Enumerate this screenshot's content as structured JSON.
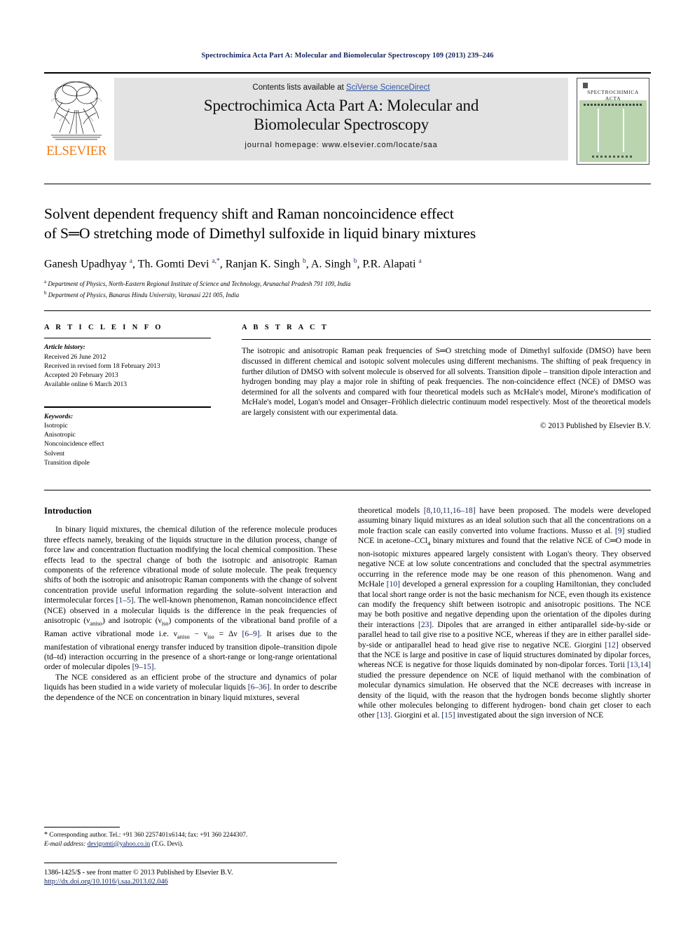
{
  "running_head": "Spectrochimica Acta Part A: Molecular and Biomolecular Spectroscopy 109 (2013) 239–246",
  "masthead": {
    "publisher_logo_text": "ELSEVIER",
    "contents_prefix": "Contents lists available at ",
    "contents_link": "SciVerse ScienceDirect",
    "journal_title_line1": "Spectrochimica Acta Part A: Molecular and",
    "journal_title_line2": "Biomolecular Spectroscopy",
    "homepage": "journal homepage: www.elsevier.com/locate/saa",
    "cover_title_line1": "SPECTROCHIMICA",
    "cover_title_line2": "ACTA"
  },
  "article": {
    "title_line1": "Solvent dependent frequency shift and Raman noncoincidence effect",
    "title_line2": "of S═O stretching mode of Dimethyl sulfoxide in liquid binary mixtures",
    "authors": "Ganesh Upadhyay <sup>a</sup>, Th. Gomti Devi <sup>a,*</sup>, Ranjan K. Singh <sup>b</sup>, A. Singh <sup>b</sup>, P.R. Alapati <sup>a</sup>",
    "affiliation_a": "<sup>a</sup> Department of Physics, North-Eastern Regional Institute of Science and Technology, Arunachal Pradesh 791 109, India",
    "affiliation_b": "<sup>b</sup> Department of Physics, Banaras Hindu University, Varanasi 221 005, India"
  },
  "article_info": {
    "heading": "A R T I C L E  I N F O",
    "history_label": "Article history:",
    "history": [
      "Received 26 June 2012",
      "Received in revised form 18 February 2013",
      "Accepted 20 February 2013",
      "Available online 6 March 2013"
    ],
    "keywords_label": "Keywords:",
    "keywords": [
      "Isotropic",
      "Anisotropic",
      "Noncoincidence effect",
      "Solvent",
      "Transition dipole"
    ]
  },
  "abstract": {
    "heading": "A B S T R A C T",
    "text": "The isotropic and anisotropic Raman peak frequencies of S═O stretching mode of Dimethyl sulfoxide (DMSO) have been discussed in different chemical and isotopic solvent molecules using different mechanisms. The shifting of peak frequency in further dilution of DMSO with solvent molecule is observed for all solvents. Transition dipole – transition dipole interaction and hydrogen bonding may play a major role in shifting of peak frequencies. The non-coincidence effect (NCE) of DMSO was determined for all the solvents and compared with four theoretical models such as McHale's model, Mirone's modification of McHale's model, Logan's model and Onsager–Fröhlich dielectric continuum model respectively. Most of the theoretical models are largely consistent with our experimental data.",
    "copyright": "© 2013 Published by Elsevier B.V."
  },
  "body": {
    "intro_heading": "Introduction",
    "left_para1": "In binary liquid mixtures, the chemical dilution of the reference molecule produces three effects namely, breaking of the liquids structure in the dilution process, change of force law and concentration fluctuation modifying the local chemical composition. These effects lead to the spectral change of both the isotropic and anisotropic Raman components of the reference vibrational mode of solute molecule. The peak frequency shifts of both the isotropic and anisotropic Raman components with the change of solvent concentration provide useful information regarding the solute–solvent interaction and intermolecular forces [1–5]. The well-known phenomenon, Raman noncoincidence effect (NCE) observed in a molecular liquids is the difference in the peak frequencies of anisotropic (&nu;<span class=\"sub\">aniso</span>) and isotropic (&nu;<span class=\"sub\">iso</span>) components of the vibrational band profile of a Raman active vibrational mode i.e. &nu;<span class=\"sub\">aniso</span> − &nu;<span class=\"sub\">iso</span> = &Delta;&nu; [6–9]. It arises due to the manifestation of vibrational energy transfer induced by transition dipole–transition dipole (td–td) interaction occurring in the presence of a short-range or long-range orientational order of molecular dipoles [9–15].",
    "left_para2": "The NCE considered as an efficient probe of the structure and dynamics of polar liquids has been studied in a wide variety of molecular liquids [6–36]. In order to describe the dependence of the NCE on concentration in binary liquid mixtures, several",
    "right_para1": "theoretical models [8,10,11,16–18] have been proposed. The models were developed assuming binary liquid mixtures as an ideal solution such that all the concentrations on a mole fraction scale can easily converted into volume fractions. Musso et al. [9] studied NCE in acetone–CCl<span class=\"sub\">4</span> binary mixtures and found that the relative NCE of C═O mode in non-isotopic mixtures appeared largely consistent with Logan's theory. They observed negative NCE at low solute concentrations and concluded that the spectral asymmetries occurring in the reference mode may be one reason of this phenomenon. Wang and McHale [10] developed a general expression for a coupling Hamiltonian, they concluded that local short range order is not the basic mechanism for NCE, even though its existence can modify the frequency shift between isotropic and anisotropic positions. The NCE may be both positive and negative depending upon the orientation of the dipoles during their interactions [23]. Dipoles that are arranged in either antiparallel side-by-side or parallel head to tail give rise to a positive NCE, whereas if they are in either parallel side-by-side or antiparallel head to head give rise to negative NCE. Giorgini [12] observed that the NCE is large and positive in case of liquid structures dominated by dipolar forces, whereas NCE is negative for those liquids dominated by non-dipolar forces. Torii [13,14] studied the pressure dependence on NCE of liquid methanol with the combination of molecular dynamics simulation. He observed that the NCE decreases with increase in density of the liquid, with the reason that the hydrogen bonds become slightly shorter while other molecules belonging to different hydrogen- bond chain get closer to each other [13]. Giorgini et al. [15] investigated about the sign inversion of NCE"
  },
  "footnote": {
    "line1": "<span class=\"star\">*</span> Corresponding author. Tel.: +91 360 2257401x6144; fax: +91 360 2244307.",
    "line2_label": "E-mail address:",
    "line2_mail": "devigomti@yahoo.co.in",
    "line2_tail": "(T.G. Devi)."
  },
  "page_footer": {
    "line1": "1386-1425/$ - see front matter © 2013 Published by Elsevier B.V.",
    "doi": "http://dx.doi.org/10.1016/j.saa.2013.02.046"
  },
  "colors": {
    "link": "#13245c",
    "sd_link": "#2f55a4",
    "elsevier_orange": "#f07d18",
    "band_gray": "#e3e3e3",
    "cover_green": "#b9d4ae"
  }
}
